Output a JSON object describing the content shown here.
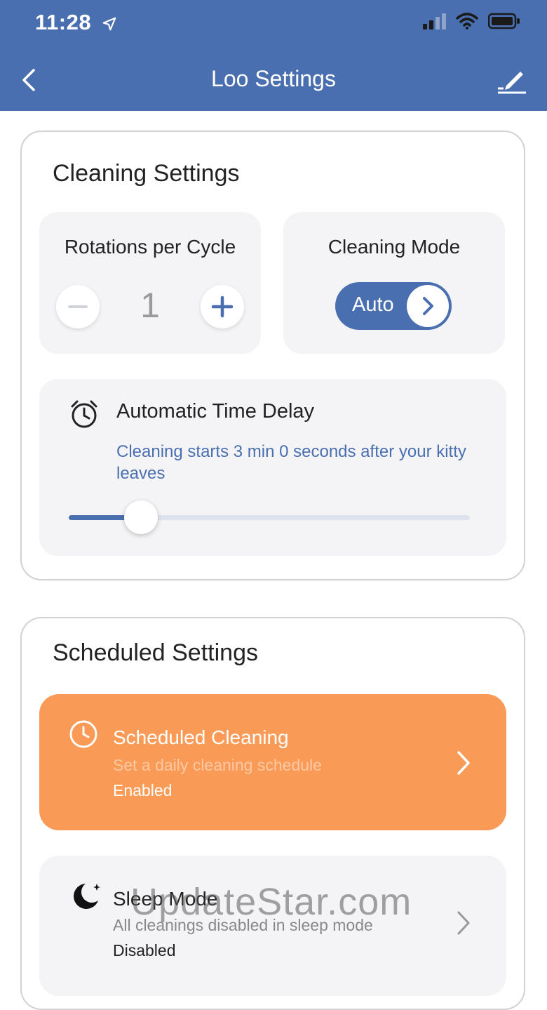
{
  "status_bar": {
    "time": "11:28"
  },
  "nav": {
    "title": "Loo Settings"
  },
  "cleaning": {
    "title": "Cleaning Settings",
    "rotations": {
      "label": "Rotations per Cycle",
      "value": "1"
    },
    "mode": {
      "label": "Cleaning Mode",
      "value": "Auto"
    },
    "delay": {
      "title": "Automatic Time Delay",
      "description": "Cleaning starts 3 min 0 seconds after your kitty leaves",
      "slider_fraction": 0.18
    }
  },
  "scheduled": {
    "title": "Scheduled Settings",
    "scheduled_cleaning": {
      "title": "Scheduled Cleaning",
      "subtitle": "Set a daily cleaning schedule",
      "status": "Enabled"
    },
    "sleep_mode": {
      "title": "Sleep Mode",
      "subtitle": "All cleanings disabled in sleep mode",
      "status": "Disabled"
    }
  },
  "watermark": "UpdateStar.com",
  "colors": {
    "primary": "#4a6fb0",
    "accent_orange": "#f99b57",
    "tile_bg": "#f4f4f6"
  },
  "icons": [
    "location-arrow-icon",
    "signal-icon",
    "wifi-icon",
    "battery-icon",
    "back-chevron-icon",
    "edit-pencil-icon",
    "minus-icon",
    "plus-icon",
    "chevron-right-icon",
    "alarm-clock-icon",
    "clock-icon",
    "moon-stars-icon"
  ]
}
